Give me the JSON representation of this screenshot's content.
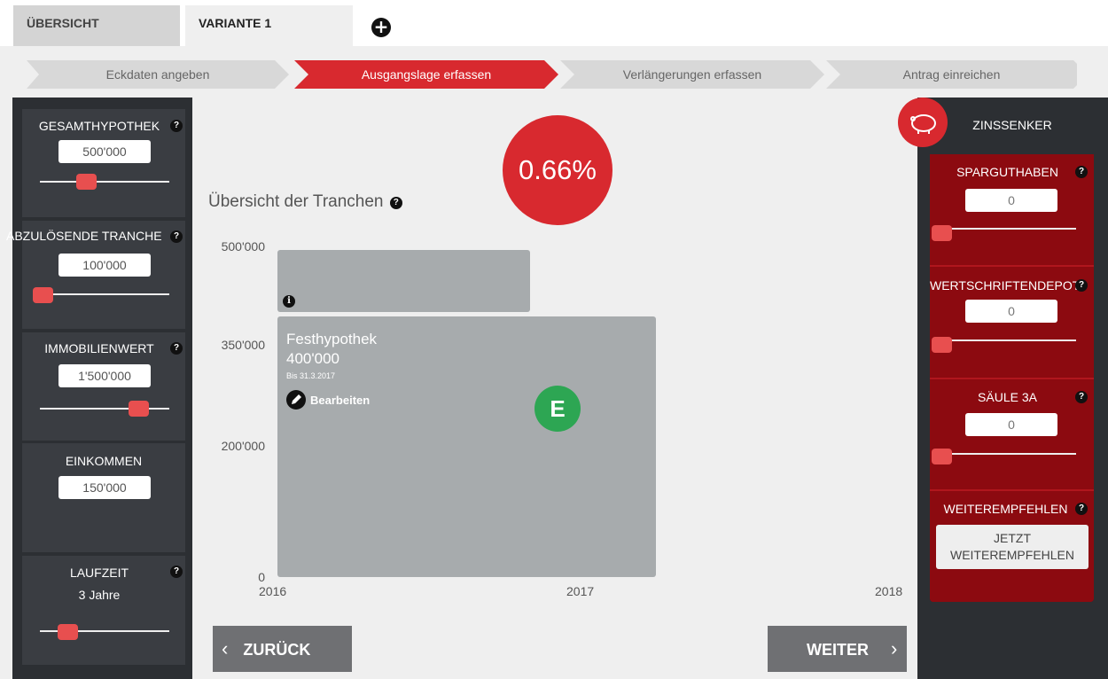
{
  "tabs": [
    {
      "label": "ÜBERSICHT"
    },
    {
      "label": "VARIANTE 1"
    }
  ],
  "add_tab_icon": "plus-circle-icon",
  "steps": [
    {
      "label": "Eckdaten angeben",
      "active": false
    },
    {
      "label": "Ausgangslage erfassen",
      "active": true
    },
    {
      "label": "Verlängerungen erfassen",
      "active": false
    },
    {
      "label": "Antrag einreichen",
      "active": false
    }
  ],
  "left_panel": {
    "gesamthypothek": {
      "title": "GESAMTHYPOTHEK",
      "value": "500'000",
      "slider_fraction": 0.35
    },
    "abzuloesende": {
      "title": "ABZULÖSENDE TRANCHE",
      "value": "100'000",
      "slider_fraction": 0.0
    },
    "immobilienwert": {
      "title": "IMMOBILIENWERT",
      "value": "1'500'000",
      "slider_fraction": 0.78
    },
    "einkommen": {
      "title": "EINKOMMEN",
      "value": "150'000"
    },
    "laufzeit": {
      "title": "LAUFZEIT",
      "value": "3 Jahre",
      "slider_fraction": 0.2
    }
  },
  "rate": "0.66%",
  "chart_title": "Übersicht der Tranchen",
  "chart_data": {
    "type": "bar",
    "yticks": [
      "500'000",
      "350'000",
      "200'000",
      "0"
    ],
    "xticks": [
      "2016",
      "2017",
      "2018"
    ],
    "bars": [
      {
        "name": "Festhypothek",
        "value": 400000,
        "start": "2016",
        "end": "31.3.2017"
      },
      {
        "value": 100000,
        "start": "2016",
        "end": "2017"
      }
    ]
  },
  "tranche": {
    "name": "Festhypothek",
    "amount": "400'000",
    "until": "Bis 31.3.2017",
    "edit_label": "Bearbeiten",
    "badge": "E"
  },
  "nav": {
    "back": "ZURÜCK",
    "next": "WEITER"
  },
  "right_panel": {
    "title": "ZINSSENKER",
    "icon": "piggy-bank-icon",
    "sparguthaben": {
      "title": "SPARGUTHABEN",
      "value": "0",
      "slider_fraction": 0.0
    },
    "wertschriften": {
      "title": "WERTSCHRIFTENDEPOT",
      "value": "0",
      "slider_fraction": 0.0
    },
    "saeule": {
      "title": "SÄULE 3A",
      "value": "0",
      "slider_fraction": 0.0
    },
    "weiterempfehlen": {
      "title": "WEITEREMPFEHLEN",
      "button": "JETZT WEITEREMPFEHLEN"
    }
  },
  "colors": {
    "accent": "#d8292f",
    "dark_red": "#8c0a10",
    "panel": "#2c2f33",
    "bar": "#a7abad",
    "badge": "#2da653"
  }
}
